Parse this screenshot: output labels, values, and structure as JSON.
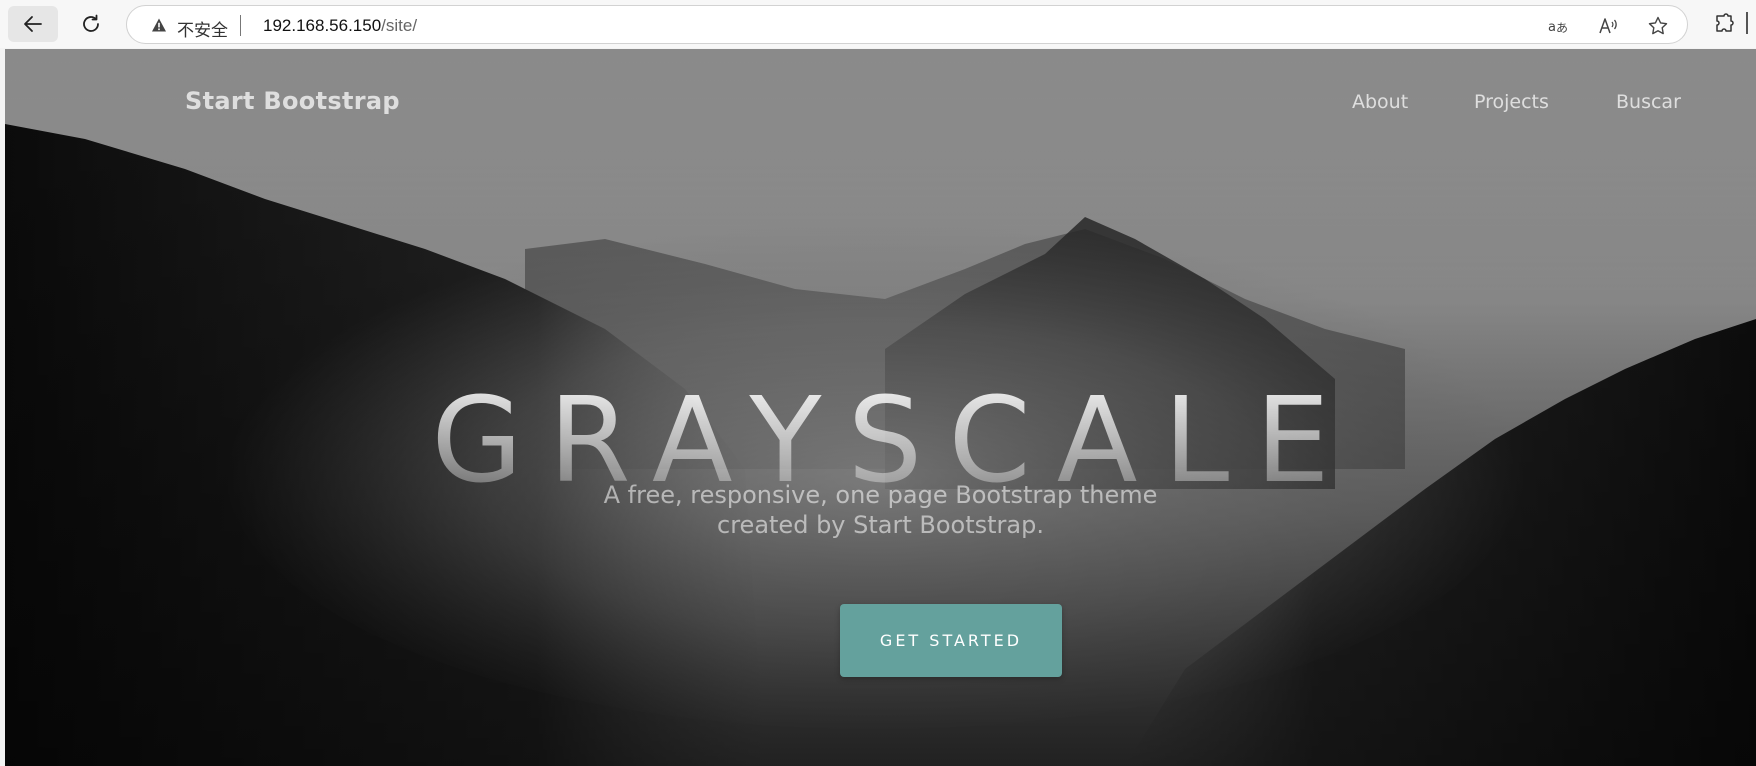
{
  "browser": {
    "security_label": "不安全",
    "url_host": "192.168.56.150",
    "url_path": "/site/"
  },
  "site": {
    "brand": "Start Bootstrap",
    "nav": [
      {
        "label": "About"
      },
      {
        "label": "Projects"
      },
      {
        "label": "Buscar"
      }
    ]
  },
  "hero": {
    "title": "GRAYSCALE",
    "subtitle_line1": "A free, responsive, one page Bootstrap theme",
    "subtitle_line2": "created by Start Bootstrap.",
    "cta_label": "GET STARTED"
  },
  "colors": {
    "cta": "#64a19d",
    "chrome": "#f7f7f7"
  }
}
